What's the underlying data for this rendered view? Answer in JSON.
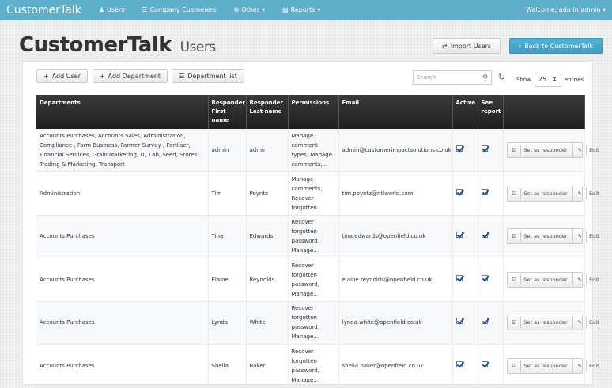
{
  "nav": {
    "brand": "CustomerTalk",
    "items": [
      {
        "label": "Users",
        "icon": "user-icon"
      },
      {
        "label": "Company Customers",
        "icon": "list-icon"
      },
      {
        "label": "Other",
        "icon": "cogs-icon"
      },
      {
        "label": "Reports",
        "icon": "chart-icon"
      }
    ],
    "welcome": "Welcome, admin admin"
  },
  "header": {
    "title": "CustomerTalk",
    "subtitle": "Users",
    "import_label": "Import Users",
    "back_label": "Back to CustomerTalk"
  },
  "toolbar": {
    "add_user": "Add User",
    "add_department": "Add Department",
    "department_list": "Department list",
    "search_placeholder": "Search",
    "show_label": "Show",
    "entries_value": "25",
    "entries_label": "entries"
  },
  "table": {
    "columns": [
      "Departments",
      "Responder First name",
      "Responder Last name",
      "Permissions",
      "Email",
      "Active",
      "See report",
      ""
    ],
    "set_responder_label": "Set as responder",
    "edit_label": "Edit",
    "rows": [
      {
        "departments": "Accounts Purchases, Accounts Sales, Administration, Compliance , Farm Business, Farmer Survey , Fertliser, Financial Services, Grain Marketing, IT, Lab, Seed, Stores, Trading & Marketing, Transport",
        "first": "admin",
        "last": "admin",
        "permissions": "Manage comment types, Manage comments,...",
        "email": "admin@customerimpactsolutions.co.uk",
        "active": true,
        "see_report": true
      },
      {
        "departments": "Administration",
        "first": "Tim",
        "last": "Poyntz",
        "permissions": "Manage comments, Recover forgotten...",
        "email": "tim.poyntz@ntlworld.com",
        "active": true,
        "see_report": true
      },
      {
        "departments": "Accounts Purchases",
        "first": "Tina",
        "last": "Edwards",
        "permissions": "Recover forgotten password, Manage...",
        "email": "tina.edwards@openfield.co.uk",
        "active": true,
        "see_report": true
      },
      {
        "departments": "Accounts Purchases",
        "first": "Elaine",
        "last": "Reynolds",
        "permissions": "Recover forgotten password, Manage...",
        "email": "elaine.reynolds@openfield.co.uk",
        "active": true,
        "see_report": true
      },
      {
        "departments": "Accounts Purchases",
        "first": "Lynda",
        "last": "White",
        "permissions": "Recover forgotten password, Manage...",
        "email": "lynda.white@openfield.co.uk",
        "active": true,
        "see_report": true
      },
      {
        "departments": "Accounts Purchases",
        "first": "Sheila",
        "last": "Baker",
        "permissions": "Recover forgotten password, Manage...",
        "email": "sheila.baker@openfield.co.uk",
        "active": true,
        "see_report": true
      }
    ]
  }
}
